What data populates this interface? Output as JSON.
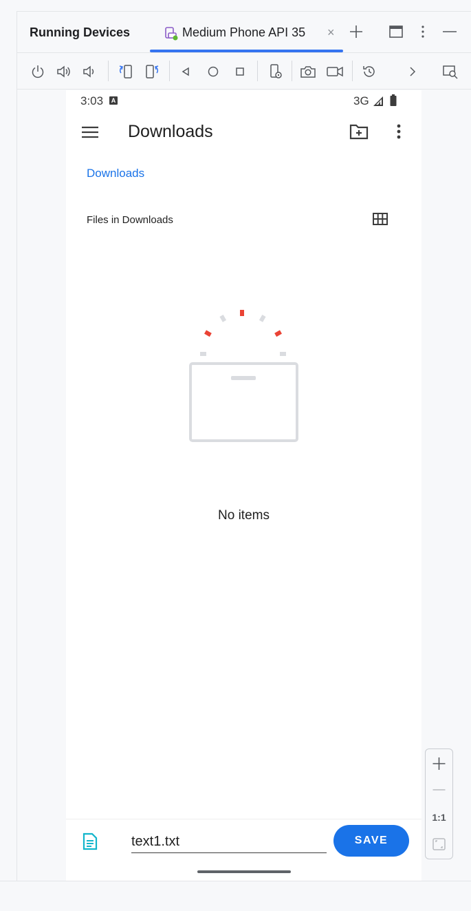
{
  "panel": {
    "title": "Running Devices"
  },
  "tab": {
    "label": "Medium Phone API 35",
    "close": "×"
  },
  "phone": {
    "status": {
      "time": "3:03",
      "keyboard_badge": "A",
      "network": "3G"
    },
    "appbar": {
      "title": "Downloads"
    },
    "breadcrumb": "Downloads",
    "section_title": "Files in Downloads",
    "empty_text": "No items",
    "save_bar": {
      "filename": "text1.txt",
      "save_label": "SAVE"
    }
  },
  "zoom": {
    "actual_size_label": "1:1"
  },
  "colors": {
    "accent": "#1a73e8",
    "tab_underline": "#3574f0",
    "device_dot": "#5fb832",
    "empty_state_red": "#ea4335"
  },
  "icons": {
    "header": [
      "device-icon",
      "close-icon",
      "add-icon",
      "window-icon",
      "more-vertical-icon",
      "minimize-icon"
    ],
    "toolbar": [
      "power-icon",
      "volume-up-icon",
      "volume-down-icon",
      "rotate-left-icon",
      "rotate-right-icon",
      "back-icon",
      "home-icon",
      "overview-icon",
      "device-settings-icon",
      "screenshot-icon",
      "screen-record-icon",
      "reset-icon",
      "chevron-right-icon",
      "inspect-icon"
    ]
  }
}
